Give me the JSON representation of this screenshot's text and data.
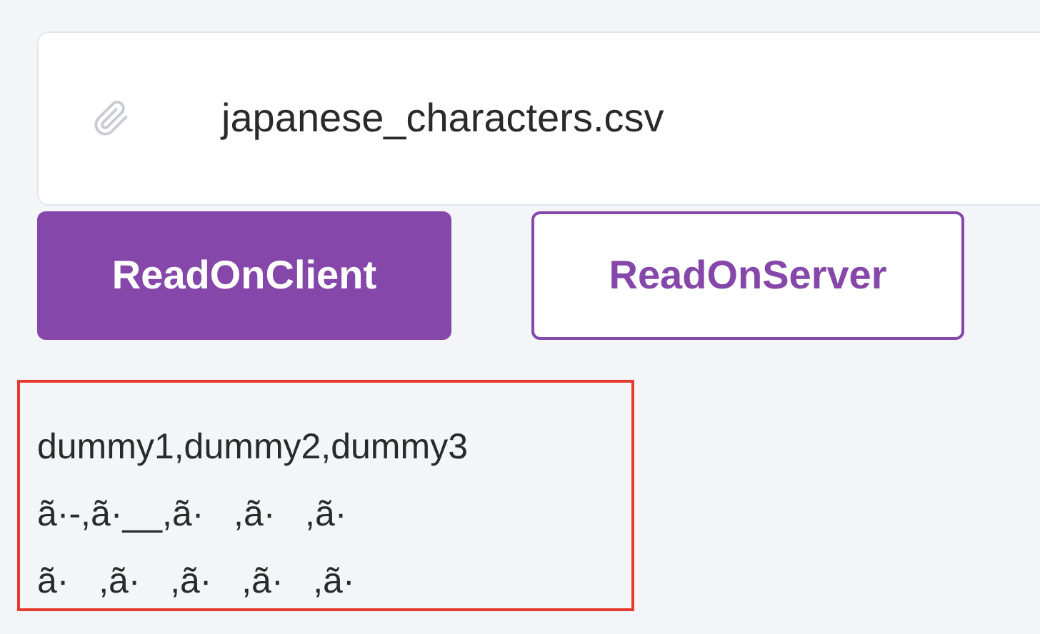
{
  "file_input": {
    "file_name": "japanese_characters.csv"
  },
  "buttons": [
    {
      "label": "ReadOnClient",
      "kind": "primary"
    },
    {
      "label": "ReadOnServer",
      "kind": "outline"
    }
  ],
  "output": {
    "lines": [
      "dummy1,dummy2,dummy3",
      "ã·-,ã·__,ã·   ,ã·   ,ã·",
      "ã·   ,ã·   ,ã·   ,ã·   ,ã·"
    ]
  }
}
